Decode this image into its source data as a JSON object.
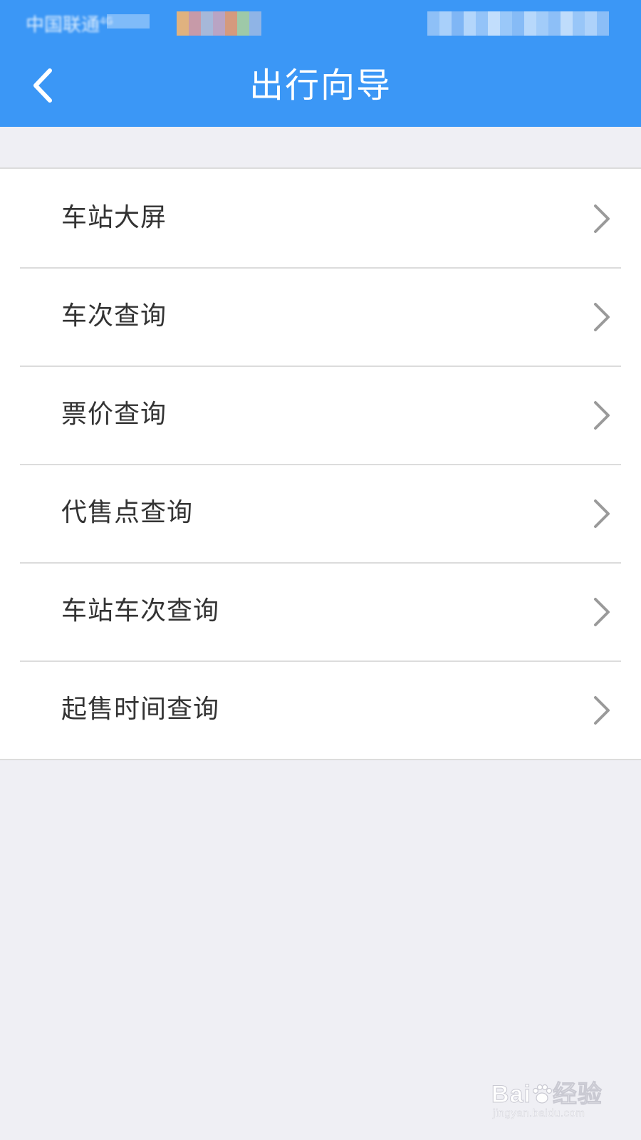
{
  "status_bar": {
    "carrier": "中国联通",
    "network": "4G"
  },
  "header": {
    "title": "出行向导",
    "back_icon": "chevron-left-icon"
  },
  "menu": {
    "items": [
      {
        "label": "车站大屏",
        "icon": "chevron-right-icon"
      },
      {
        "label": "车次查询",
        "icon": "chevron-right-icon"
      },
      {
        "label": "票价查询",
        "icon": "chevron-right-icon"
      },
      {
        "label": "代售点查询",
        "icon": "chevron-right-icon"
      },
      {
        "label": "车站车次查询",
        "icon": "chevron-right-icon"
      },
      {
        "label": "起售时间查询",
        "icon": "chevron-right-icon"
      }
    ]
  },
  "watermark": {
    "logo_text_1": "Bai",
    "logo_text_2": "经验",
    "url": "jingyan.baidu.com"
  },
  "colors": {
    "header_bg": "#3b97f6",
    "page_bg": "#efeff4",
    "list_bg": "#ffffff",
    "divider": "#dcdcdc",
    "text": "#333333",
    "chevron": "#9a9a9a"
  }
}
